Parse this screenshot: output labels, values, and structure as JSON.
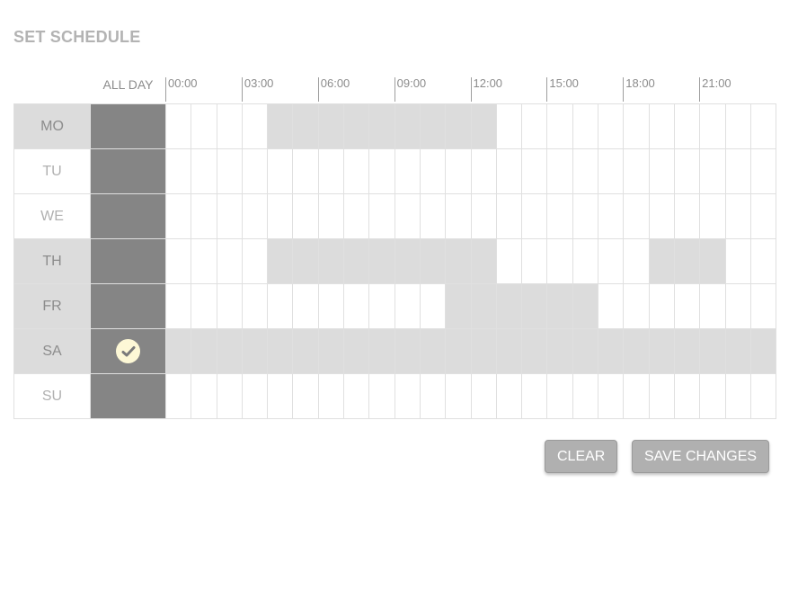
{
  "title": "SET SCHEDULE",
  "all_day_label": "ALL DAY",
  "hour_labels": [
    "00:00",
    "03:00",
    "06:00",
    "09:00",
    "12:00",
    "15:00",
    "18:00",
    "21:00"
  ],
  "days": [
    {
      "label": "MO",
      "active": true,
      "all_day": false,
      "hours": [
        4,
        5,
        6,
        7,
        8,
        9,
        10,
        11,
        12
      ]
    },
    {
      "label": "TU",
      "active": false,
      "all_day": false,
      "hours": []
    },
    {
      "label": "WE",
      "active": false,
      "all_day": false,
      "hours": []
    },
    {
      "label": "TH",
      "active": true,
      "all_day": false,
      "hours": [
        4,
        5,
        6,
        7,
        8,
        9,
        10,
        11,
        12,
        19,
        20,
        21
      ]
    },
    {
      "label": "FR",
      "active": true,
      "all_day": false,
      "hours": [
        11,
        12,
        13,
        14,
        15,
        16
      ]
    },
    {
      "label": "SA",
      "active": true,
      "all_day": true,
      "hours": [
        0,
        1,
        2,
        3,
        4,
        5,
        6,
        7,
        8,
        9,
        10,
        11,
        12,
        13,
        14,
        15,
        16,
        17,
        18,
        19,
        20,
        21,
        22,
        23
      ]
    },
    {
      "label": "SU",
      "active": false,
      "all_day": false,
      "hours": []
    }
  ],
  "buttons": {
    "clear": "CLEAR",
    "save": "SAVE CHANGES"
  },
  "colors": {
    "selected": "#dcdcdc",
    "all_day_column": "#858585",
    "check_badge": "#fdf8d6"
  }
}
